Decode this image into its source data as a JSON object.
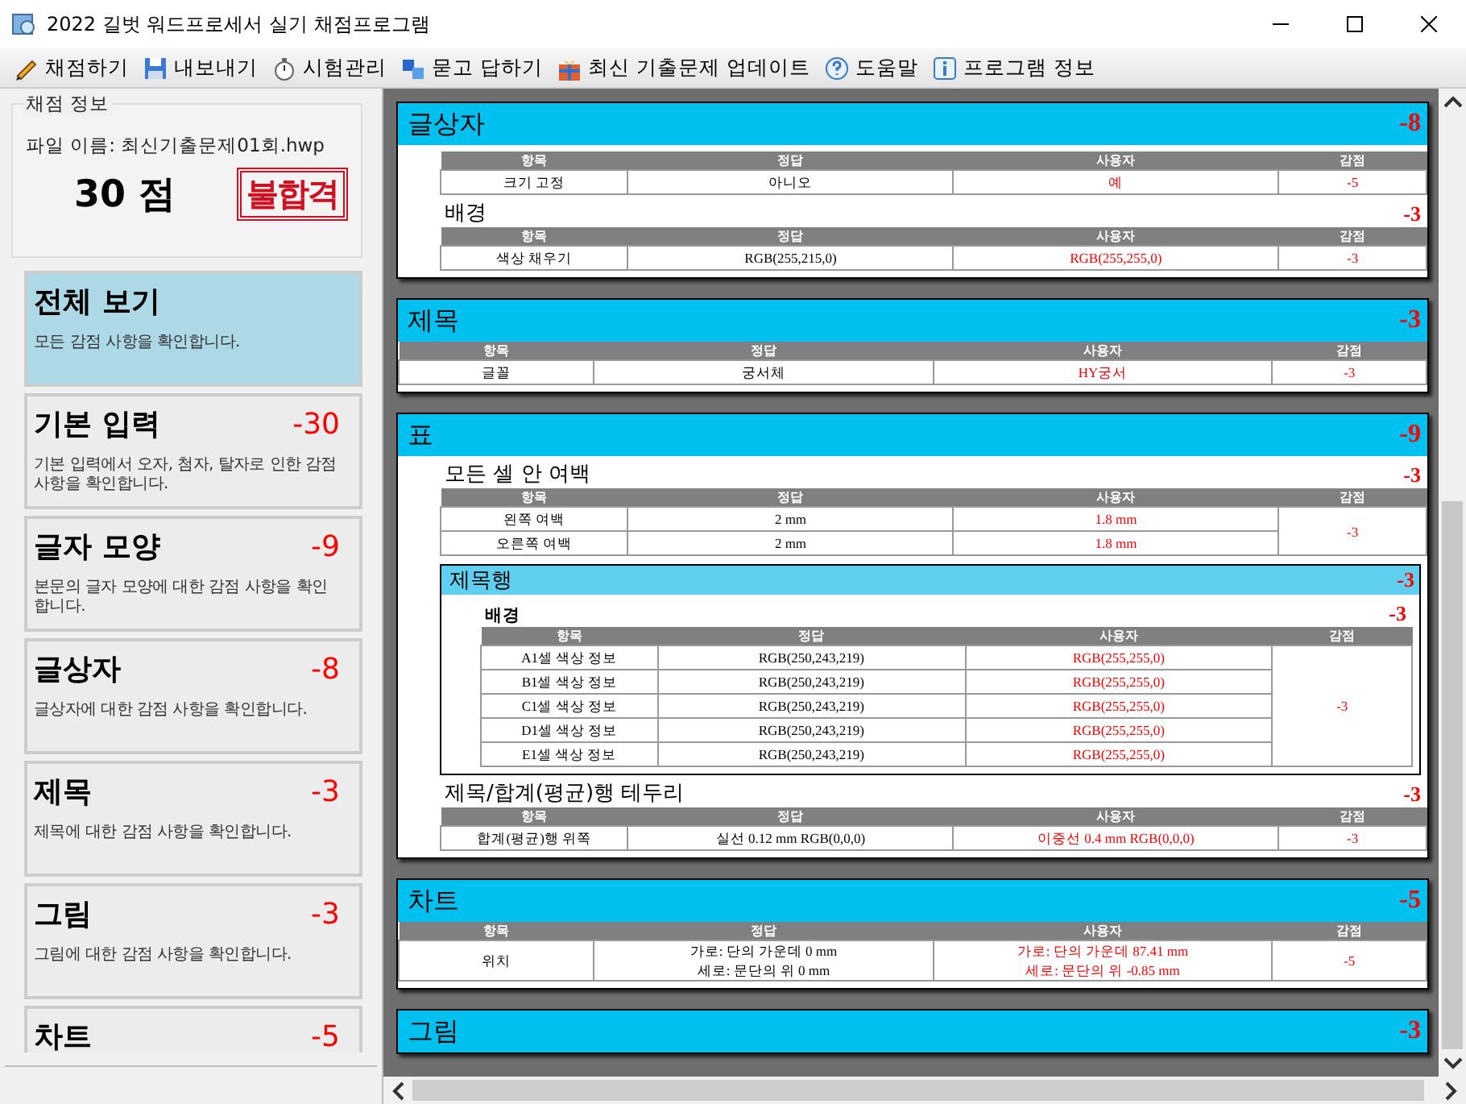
{
  "window": {
    "title": "2022 길벗 워드프로세서 실기 채점프로그램"
  },
  "toolbar": [
    {
      "label": "채점하기"
    },
    {
      "label": "내보내기"
    },
    {
      "label": "시험관리"
    },
    {
      "label": "묻고 답하기"
    },
    {
      "label": "최신 기출문제 업데이트"
    },
    {
      "label": "도움말"
    },
    {
      "label": "프로그램 정보"
    }
  ],
  "score_panel": {
    "title": "채점 정보",
    "file": "파일 이름: 최신기출문제01회.hwp",
    "score": "30 점",
    "stamp": "불합격"
  },
  "categories": [
    {
      "title": "전체 보기",
      "desc": "모든 감점 사항을 확인합니다.",
      "selected": true
    },
    {
      "title": "기본 입력",
      "deduction": "-30",
      "desc": "기본 입력에서 오자, 첨자, 탈자로 인한 감점 사항을 확인합니다.",
      "selected": false
    },
    {
      "title": "글자 모양",
      "deduction": "-9",
      "desc": "본문의 글자 모양에 대한 감점 사항을 확인합니다.",
      "selected": false
    },
    {
      "title": "글상자",
      "deduction": "-8",
      "desc": "글상자에 대한 감점 사항을 확인합니다.",
      "selected": false
    },
    {
      "title": "제목",
      "deduction": "-3",
      "desc": "제목에 대한 감점 사항을 확인합니다.",
      "selected": false
    },
    {
      "title": "그림",
      "deduction": "-3",
      "desc": "그림에 대한 감점 사항을 확인합니다.",
      "selected": false
    },
    {
      "title": "차트",
      "deduction": "-5",
      "selected": false
    }
  ],
  "report": [
    {
      "title": "글상자",
      "deduction": "-8",
      "blocks": [
        {
          "kind": "subsection",
          "table": {
            "columns": [
              "항목",
              "정답",
              "사용자",
              "감점"
            ],
            "rows": [
              [
                "크기 고정",
                "아니오",
                "예"
              ]
            ],
            "deduction": "-5"
          }
        },
        {
          "kind": "subsection",
          "title": "배경",
          "deduction": "-3",
          "table": {
            "columns": [
              "항목",
              "정답",
              "사용자",
              "감점"
            ],
            "rows": [
              [
                "색상 채우기",
                "RGB(255,215,0)",
                "RGB(255,255,0)"
              ]
            ],
            "deduction": "-3"
          }
        }
      ]
    },
    {
      "title": "제목",
      "deduction": "-3",
      "blocks": [
        {
          "kind": "table",
          "table": {
            "columns": [
              "항목",
              "정답",
              "사용자",
              "감점"
            ],
            "rows": [
              [
                "글꼴",
                "궁서체",
                "HY궁서"
              ]
            ],
            "deduction": "-3"
          }
        }
      ]
    },
    {
      "title": "표",
      "deduction": "-9",
      "blocks": [
        {
          "kind": "subsection",
          "title": "모든 셀 안 여백",
          "deduction": "-3",
          "table": {
            "columns": [
              "항목",
              "정답",
              "사용자",
              "감점"
            ],
            "rows": [
              [
                "왼쪽 여백",
                "2 mm",
                "1.8 mm"
              ],
              [
                "오른쪽 여백",
                "2 mm",
                "1.8 mm"
              ]
            ],
            "deduction": "-3"
          }
        },
        {
          "kind": "box",
          "title": "제목행",
          "deduction": "-3",
          "blocks": [
            {
              "kind": "subsection",
              "title": "배경",
              "deduction": "-3",
              "table": {
                "columns": [
                  "항목",
                  "정답",
                  "사용자",
                  "감점"
                ],
                "rows": [
                  [
                    "A1셀 색상 정보",
                    "RGB(250,243,219)",
                    "RGB(255,255,0)"
                  ],
                  [
                    "B1셀 색상 정보",
                    "RGB(250,243,219)",
                    "RGB(255,255,0)"
                  ],
                  [
                    "C1셀 색상 정보",
                    "RGB(250,243,219)",
                    "RGB(255,255,0)"
                  ],
                  [
                    "D1셀 색상 정보",
                    "RGB(250,243,219)",
                    "RGB(255,255,0)"
                  ],
                  [
                    "E1셀 색상 정보",
                    "RGB(250,243,219)",
                    "RGB(255,255,0)"
                  ]
                ],
                "deduction": "-3"
              }
            }
          ]
        },
        {
          "kind": "subsection",
          "title": "제목/합계(평균)행 테두리",
          "deduction": "-3",
          "table": {
            "columns": [
              "항목",
              "정답",
              "사용자",
              "감점"
            ],
            "rows": [
              [
                "합계(평균)행 위쪽",
                "실선 0.12 mm RGB(0,0,0)",
                "이중선 0.4 mm RGB(0,0,0)"
              ]
            ],
            "deduction": "-3"
          }
        }
      ]
    },
    {
      "title": "차트",
      "deduction": "-5",
      "blocks": [
        {
          "kind": "table",
          "table": {
            "columns": [
              "항목",
              "정답",
              "사용자",
              "감점"
            ],
            "rows": [
              [
                "위치",
                "가로: 단의 가운데 0 mm\n세로: 문단의 위 0 mm",
                "가로: 단의 가운데 87.41 mm\n세로: 문단의 위 -0.85 mm"
              ]
            ],
            "deduction": "-5"
          }
        }
      ]
    },
    {
      "title": "그림",
      "deduction": "-3"
    }
  ]
}
